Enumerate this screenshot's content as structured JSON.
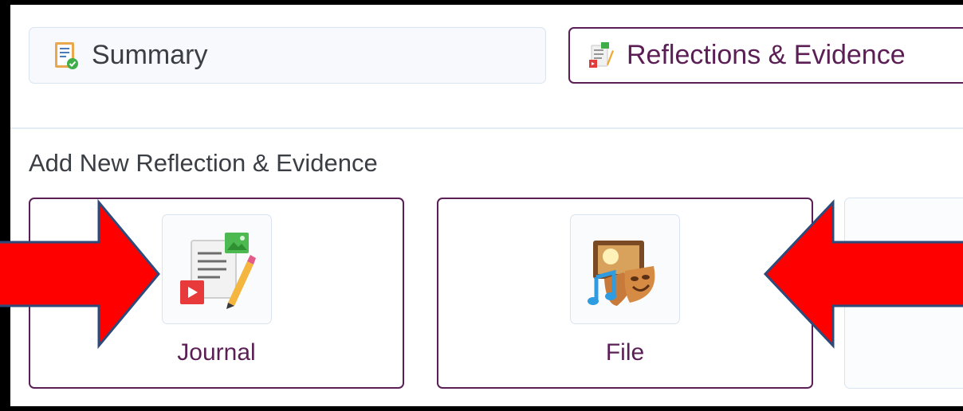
{
  "tabs": [
    {
      "label": "Summary",
      "icon": "summary-report-icon"
    },
    {
      "label": "Reflections & Evidence",
      "icon": "reflection-journal-icon"
    }
  ],
  "section": {
    "heading": "Add New Reflection & Evidence"
  },
  "cards": [
    {
      "label": "Journal",
      "icon": "journal-icon"
    },
    {
      "label": "File",
      "icon": "file-media-icon"
    }
  ],
  "annotations": {
    "arrow_color": "#ff0000",
    "arrow_outline_color": "#2c4a7a"
  },
  "colors": {
    "accent": "#5b1f56",
    "border_light": "#d9e4f0",
    "text": "#3b3f45"
  }
}
